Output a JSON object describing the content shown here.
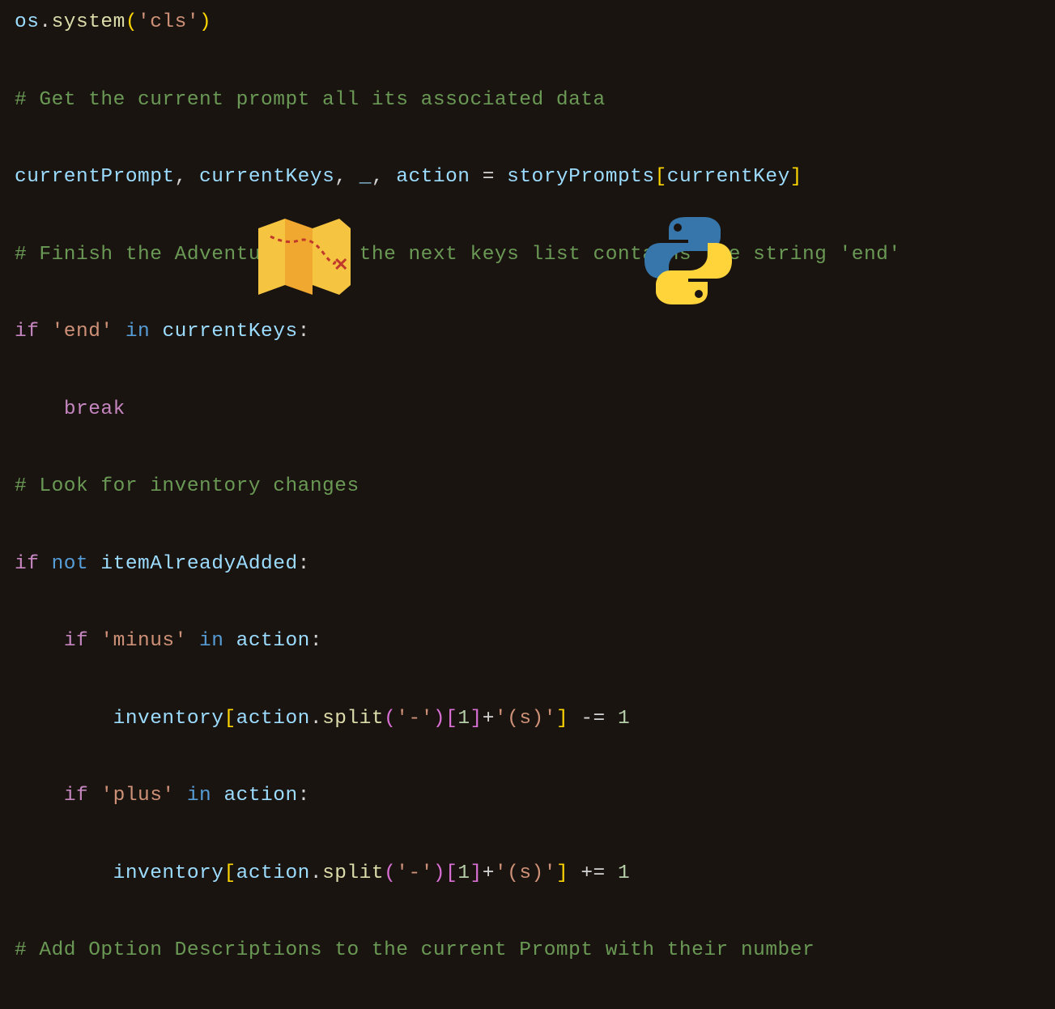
{
  "code": {
    "line1": {
      "t1": "os",
      "t2": ".",
      "t3": "system",
      "t4": "(",
      "t5": "'cls'",
      "t6": ")"
    },
    "line2": {
      "t1": "# Get the current prompt all its associated data"
    },
    "line3": {
      "t1": "currentPrompt",
      "t2": ", ",
      "t3": "currentKeys",
      "t4": ", ",
      "t5": "_",
      "t6": ", ",
      "t7": "action",
      "t8": " = ",
      "t9": "storyPrompts",
      "t10": "[",
      "t11": "currentKey",
      "t12": "]"
    },
    "line4": {
      "t1": "# Finish the Adventure when the next keys list contains the string 'end'"
    },
    "line5": {
      "t1": "if",
      "t2": " ",
      "t3": "'end'",
      "t4": " ",
      "t5": "in",
      "t6": " ",
      "t7": "currentKeys",
      "t8": ":"
    },
    "line6": {
      "indent": "    ",
      "t1": "break"
    },
    "line7": {
      "t1": "# Look for inventory changes"
    },
    "line8": {
      "t1": "if",
      "t2": " ",
      "t3": "not",
      "t4": " ",
      "t5": "itemAlreadyAdded",
      "t6": ":"
    },
    "line9": {
      "indent": "    ",
      "t1": "if",
      "t2": " ",
      "t3": "'minus'",
      "t4": " ",
      "t5": "in",
      "t6": " ",
      "t7": "action",
      "t8": ":"
    },
    "line10": {
      "indent": "        ",
      "t1": "inventory",
      "t2": "[",
      "t3": "action",
      "t4": ".",
      "t5": "split",
      "t6": "(",
      "t7": "'-'",
      "t8": ")",
      "t9": "[",
      "t10": "1",
      "t11": "]",
      "t12": "+",
      "t13": "'(s)'",
      "t14": "]",
      "t15": " -= ",
      "t16": "1"
    },
    "line11": {
      "indent": "    ",
      "t1": "if",
      "t2": " ",
      "t3": "'plus'",
      "t4": " ",
      "t5": "in",
      "t6": " ",
      "t7": "action",
      "t8": ":"
    },
    "line12": {
      "indent": "        ",
      "t1": "inventory",
      "t2": "[",
      "t3": "action",
      "t4": ".",
      "t5": "split",
      "t6": "(",
      "t7": "'-'",
      "t8": ")",
      "t9": "[",
      "t10": "1",
      "t11": "]",
      "t12": "+",
      "t13": "'(s)'",
      "t14": "]",
      "t15": " += ",
      "t16": "1"
    },
    "line13": {
      "t1": "# Add Option Descriptions to the current Prompt with their number"
    }
  },
  "icons": {
    "map": "treasure-map-icon",
    "python": "python-logo-icon"
  }
}
